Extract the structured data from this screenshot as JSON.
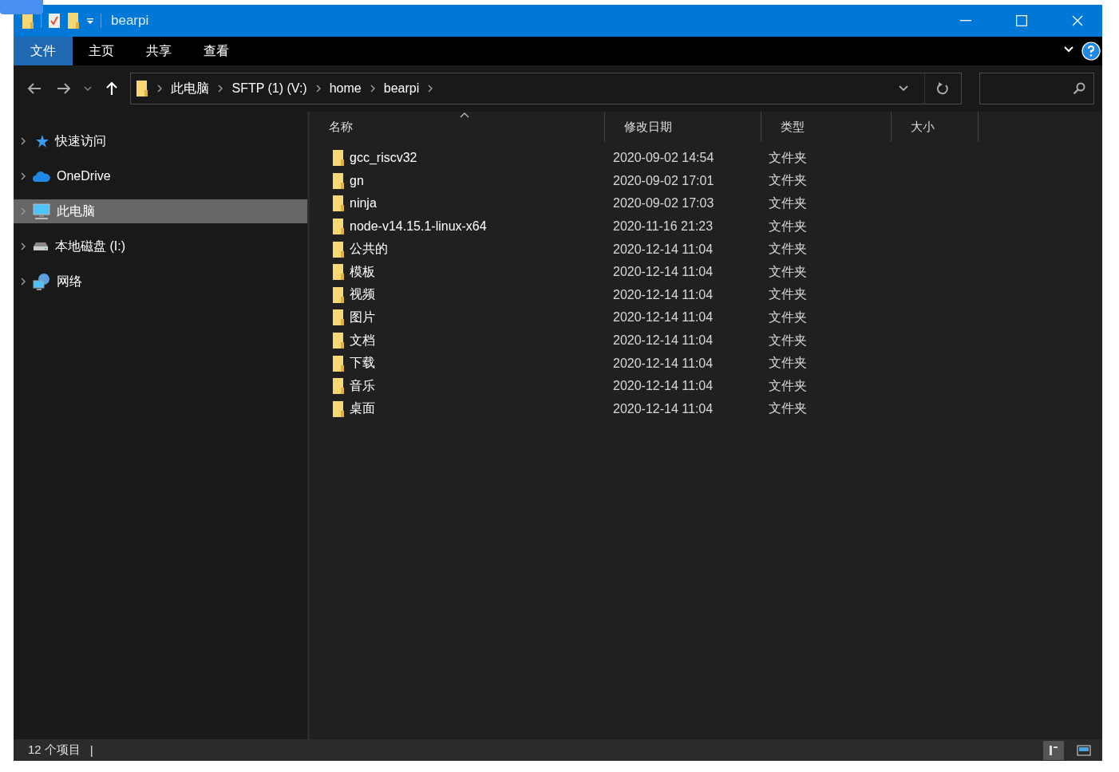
{
  "window": {
    "title": "bearpi"
  },
  "ribbon_tabs": [
    {
      "label": "文件",
      "selected": true
    },
    {
      "label": "主页",
      "selected": false
    },
    {
      "label": "共享",
      "selected": false
    },
    {
      "label": "查看",
      "selected": false
    }
  ],
  "address": {
    "breadcrumbs": [
      "此电脑",
      "SFTP (1) (V:)",
      "home",
      "bearpi"
    ]
  },
  "sidebar": {
    "items": [
      {
        "label": "快速访问",
        "kind": "star",
        "selected": false
      },
      {
        "label": "OneDrive",
        "kind": "cloud",
        "selected": false
      },
      {
        "label": "此电脑",
        "kind": "computer",
        "selected": true
      },
      {
        "label": "本地磁盘 (I:)",
        "kind": "drive",
        "selected": false
      },
      {
        "label": "网络",
        "kind": "network",
        "selected": false
      }
    ]
  },
  "table": {
    "columns": [
      "名称",
      "修改日期",
      "类型",
      "大小"
    ],
    "rows": [
      {
        "name": "gcc_riscv32",
        "modified": "2020-09-02 14:54",
        "type": "文件夹"
      },
      {
        "name": "gn",
        "modified": "2020-09-02 17:01",
        "type": "文件夹"
      },
      {
        "name": "ninja",
        "modified": "2020-09-02 17:03",
        "type": "文件夹"
      },
      {
        "name": "node-v14.15.1-linux-x64",
        "modified": "2020-11-16 21:23",
        "type": "文件夹"
      },
      {
        "name": "公共的",
        "modified": "2020-12-14 11:04",
        "type": "文件夹"
      },
      {
        "name": "模板",
        "modified": "2020-12-14 11:04",
        "type": "文件夹"
      },
      {
        "name": "视频",
        "modified": "2020-12-14 11:04",
        "type": "文件夹"
      },
      {
        "name": "图片",
        "modified": "2020-12-14 11:04",
        "type": "文件夹"
      },
      {
        "name": "文档",
        "modified": "2020-12-14 11:04",
        "type": "文件夹"
      },
      {
        "name": "下载",
        "modified": "2020-12-14 11:04",
        "type": "文件夹"
      },
      {
        "name": "音乐",
        "modified": "2020-12-14 11:04",
        "type": "文件夹"
      },
      {
        "name": "桌面",
        "modified": "2020-12-14 11:04",
        "type": "文件夹"
      }
    ]
  },
  "status_bar": {
    "count": "12 个项目",
    "separator": "|"
  }
}
